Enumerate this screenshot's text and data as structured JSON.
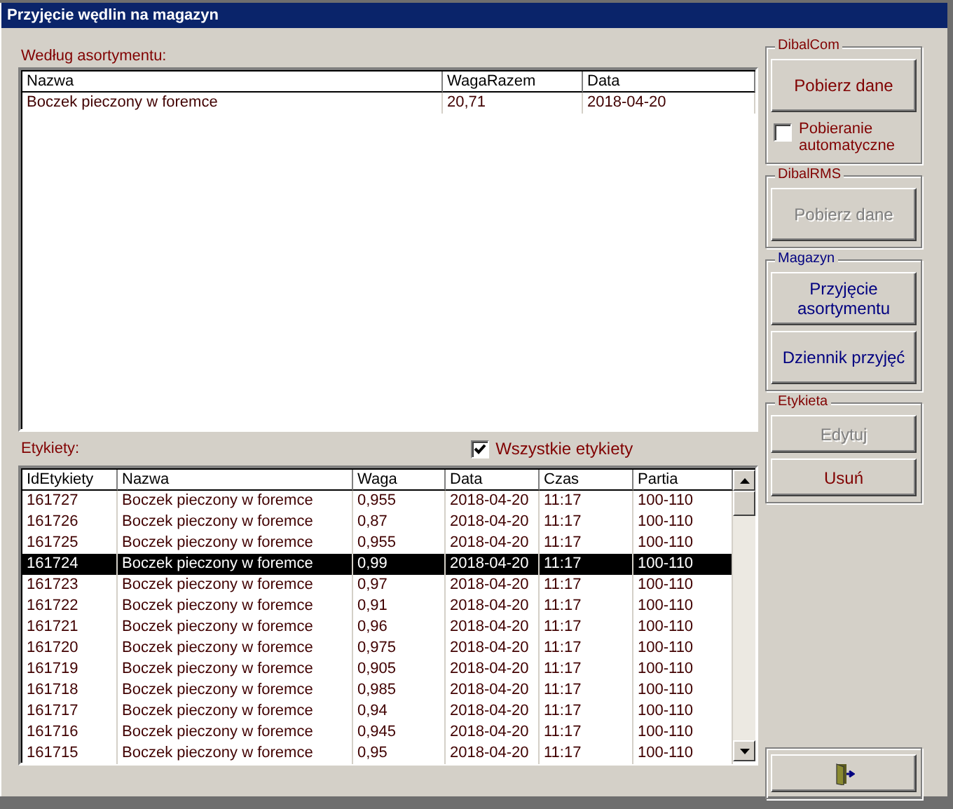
{
  "window": {
    "title": "Przyjęcie wędlin na magazyn"
  },
  "assortment": {
    "label": "Według asortymentu:",
    "columns": [
      "Nazwa",
      "WagaRazem",
      "Data"
    ],
    "rows": [
      [
        "Boczek pieczony w foremce",
        "20,71",
        "2018-04-20"
      ]
    ]
  },
  "labels": {
    "label": "Etykiety:",
    "all_labels": {
      "label": "Wszystkie etykiety",
      "checked": true
    },
    "columns": [
      "IdEtykiety",
      "Nazwa",
      "Waga",
      "Data",
      "Czas",
      "Partia"
    ],
    "rows": [
      {
        "cells": [
          "161727",
          "Boczek pieczony w foremce",
          "0,955",
          "2018-04-20",
          "11:17",
          "100-110"
        ],
        "selected": false
      },
      {
        "cells": [
          "161726",
          "Boczek pieczony w foremce",
          "0,87",
          "2018-04-20",
          "11:17",
          "100-110"
        ],
        "selected": false
      },
      {
        "cells": [
          "161725",
          "Boczek pieczony w foremce",
          "0,955",
          "2018-04-20",
          "11:17",
          "100-110"
        ],
        "selected": false
      },
      {
        "cells": [
          "161724",
          "Boczek pieczony w foremce",
          "0,99",
          "2018-04-20",
          "11:17",
          "100-110"
        ],
        "selected": true
      },
      {
        "cells": [
          "161723",
          "Boczek pieczony w foremce",
          "0,97",
          "2018-04-20",
          "11:17",
          "100-110"
        ],
        "selected": false
      },
      {
        "cells": [
          "161722",
          "Boczek pieczony w foremce",
          "0,91",
          "2018-04-20",
          "11:17",
          "100-110"
        ],
        "selected": false
      },
      {
        "cells": [
          "161721",
          "Boczek pieczony w foremce",
          "0,96",
          "2018-04-20",
          "11:17",
          "100-110"
        ],
        "selected": false
      },
      {
        "cells": [
          "161720",
          "Boczek pieczony w foremce",
          "0,975",
          "2018-04-20",
          "11:17",
          "100-110"
        ],
        "selected": false
      },
      {
        "cells": [
          "161719",
          "Boczek pieczony w foremce",
          "0,905",
          "2018-04-20",
          "11:17",
          "100-110"
        ],
        "selected": false
      },
      {
        "cells": [
          "161718",
          "Boczek pieczony w foremce",
          "0,985",
          "2018-04-20",
          "11:17",
          "100-110"
        ],
        "selected": false
      },
      {
        "cells": [
          "161717",
          "Boczek pieczony w foremce",
          "0,94",
          "2018-04-20",
          "11:17",
          "100-110"
        ],
        "selected": false
      },
      {
        "cells": [
          "161716",
          "Boczek pieczony w foremce",
          "0,945",
          "2018-04-20",
          "11:17",
          "100-110"
        ],
        "selected": false
      },
      {
        "cells": [
          "161715",
          "Boczek pieczony w foremce",
          "0,95",
          "2018-04-20",
          "11:17",
          "100-110"
        ],
        "selected": false
      }
    ]
  },
  "groups": [
    {
      "title": "DibalCom",
      "color": "#800000",
      "buttons": [
        {
          "label": "Pobierz dane",
          "disabled": false
        }
      ],
      "checkbox": {
        "label": "Pobieranie automatyczne",
        "checked": false
      }
    },
    {
      "title": "DibalRMS",
      "color": "#800000",
      "buttons": [
        {
          "label": "Pobierz dane",
          "disabled": true
        }
      ]
    },
    {
      "title": "Magazyn",
      "color": "#000080",
      "buttons": [
        {
          "label": "Przyjęcie asortymentu",
          "disabled": false
        },
        {
          "label": "Dziennik  przyjęć",
          "disabled": false
        }
      ]
    },
    {
      "title": "Etykieta",
      "color": "#800000",
      "buttons": [
        {
          "label": "Edytuj",
          "disabled": true
        },
        {
          "label": "Usuń",
          "disabled": false
        }
      ]
    }
  ]
}
